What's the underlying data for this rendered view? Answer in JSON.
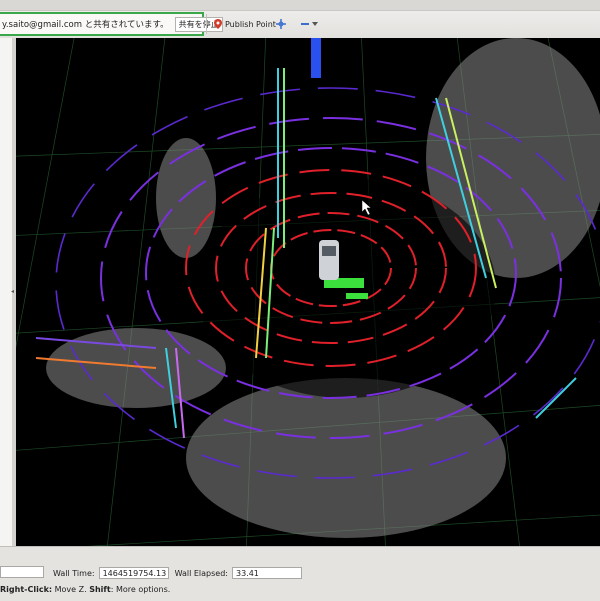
{
  "share_bar": {
    "text": "y.saito@gmail.com と共有されています。",
    "stop_button": "共有を停止"
  },
  "toolbar": {
    "publish_point": "Publish Point",
    "icons": [
      "map-pin-icon",
      "move-camera-icon",
      "minus-icon",
      "dropdown-arrow-icon"
    ]
  },
  "status": {
    "wall_time_label": "Wall Time:",
    "wall_time_value": "1464519754.13",
    "wall_elapsed_label": "Wall Elapsed:",
    "wall_elapsed_value": "33.41"
  },
  "hint": {
    "right_click": "Right-Click:",
    "right_click_text": " Move Z. ",
    "shift": "Shift",
    "shift_text": ": More options."
  },
  "scene": {
    "description_colors": {
      "ring_red": "#e0202a",
      "ring_purple": "#7a30e0",
      "grid": "#1f5a2a",
      "points": "#9a9a9a"
    }
  }
}
